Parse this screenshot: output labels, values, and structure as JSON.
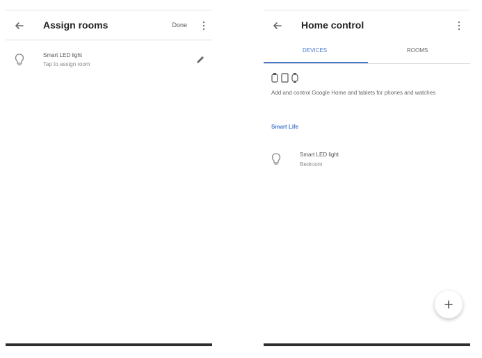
{
  "left": {
    "title": "Assign rooms",
    "action_label": "Done",
    "device": {
      "name": "Smart LED light",
      "subtitle": "Tap to assign room"
    }
  },
  "right": {
    "title": "Home control",
    "tabs": [
      {
        "label": "DEVICES",
        "active": true
      },
      {
        "label": "ROOMS",
        "active": false
      }
    ],
    "description": "Add and control Google Home and tablets for phones and watches",
    "link_label": "Smart Life",
    "device": {
      "name": "Smart LED light",
      "room": "Bedroom"
    }
  },
  "colors": {
    "accent": "#4a7bd0",
    "navbar": "#2e2e2e"
  },
  "icons": [
    "back-arrow-icon",
    "more-vert-icon",
    "bulb-icon",
    "edit-pencil-icon",
    "plus-icon",
    "device-icons"
  ]
}
